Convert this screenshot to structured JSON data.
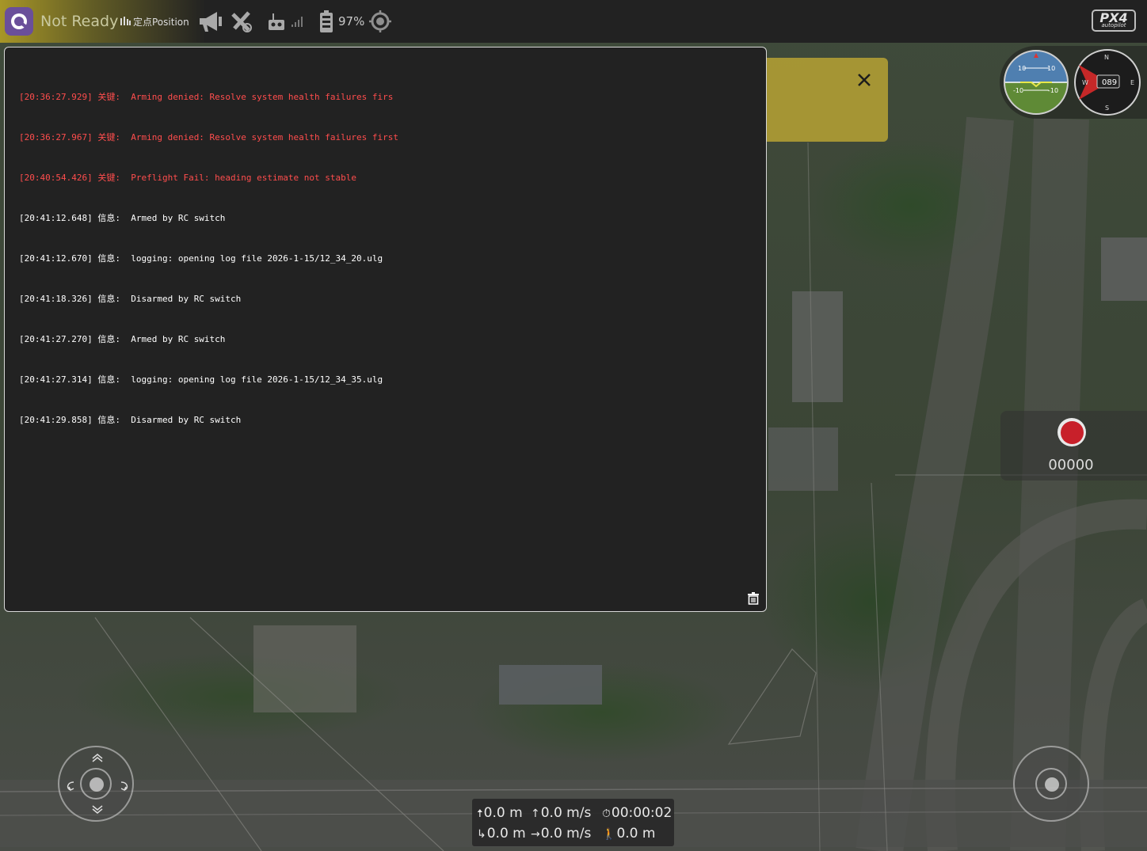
{
  "colors": {
    "toolbar_bg": "#222222",
    "critical": "#ff4d4d",
    "info": "#ffffff",
    "notice": "#ab9a34",
    "record": "#c8202a"
  },
  "toolbar": {
    "app_icon": "qgc-logo-icon",
    "status": "Not Ready",
    "flight_mode": "定点Position",
    "mode_icon": "mode-bars-icon",
    "icons": [
      "megaphone-icon",
      "gps-off-icon",
      "rc-remote-icon",
      "signal-bars-icon",
      "battery-icon",
      "gimbal-target-icon"
    ],
    "battery_percent": "97%",
    "brand_logo": "PX4"
  },
  "console": {
    "messages": [
      {
        "time": "[20:36:27.929]",
        "level": "关键:",
        "severity": "critical",
        "text": "Arming denied: Resolve system health failures firs"
      },
      {
        "time": "[20:36:27.967]",
        "level": "关键:",
        "severity": "critical",
        "text": "Arming denied: Resolve system health failures first"
      },
      {
        "time": "[20:40:54.426]",
        "level": "关键:",
        "severity": "critical",
        "text": "Preflight Fail: heading estimate not stable"
      },
      {
        "time": "[20:41:12.648]",
        "level": "信息:",
        "severity": "info",
        "text": "Armed by RC switch"
      },
      {
        "time": "[20:41:12.670]",
        "level": "信息:",
        "severity": "info",
        "text": "logging: opening log file 2026-1-15/12_34_20.ulg"
      },
      {
        "time": "[20:41:18.326]",
        "level": "信息:",
        "severity": "info",
        "text": "Disarmed by RC switch"
      },
      {
        "time": "[20:41:27.270]",
        "level": "信息:",
        "severity": "info",
        "text": "Armed by RC switch"
      },
      {
        "time": "[20:41:27.314]",
        "level": "信息:",
        "severity": "info",
        "text": "logging: opening log file 2026-1-15/12_34_35.ulg"
      },
      {
        "time": "[20:41:29.858]",
        "level": "信息:",
        "severity": "info",
        "text": "Disarmed by RC switch"
      }
    ],
    "clear_icon": "trash-icon"
  },
  "notice": {
    "close_icon": "close-icon"
  },
  "instruments": {
    "attitude_scale_top": "10",
    "attitude_scale_bottom": "-10",
    "heading": "089",
    "compass_n": "N",
    "compass_s": "S",
    "compass_e": "E",
    "compass_w": "W"
  },
  "record": {
    "time": "00000"
  },
  "telemetry": {
    "altitude": "0.0 m",
    "vertical_speed": "0.0 m/s",
    "flight_time": "00:00:02",
    "distance_home": "0.0 m",
    "horizontal_speed": "0.0 m/s",
    "distance_travelled": "0.0 m"
  }
}
